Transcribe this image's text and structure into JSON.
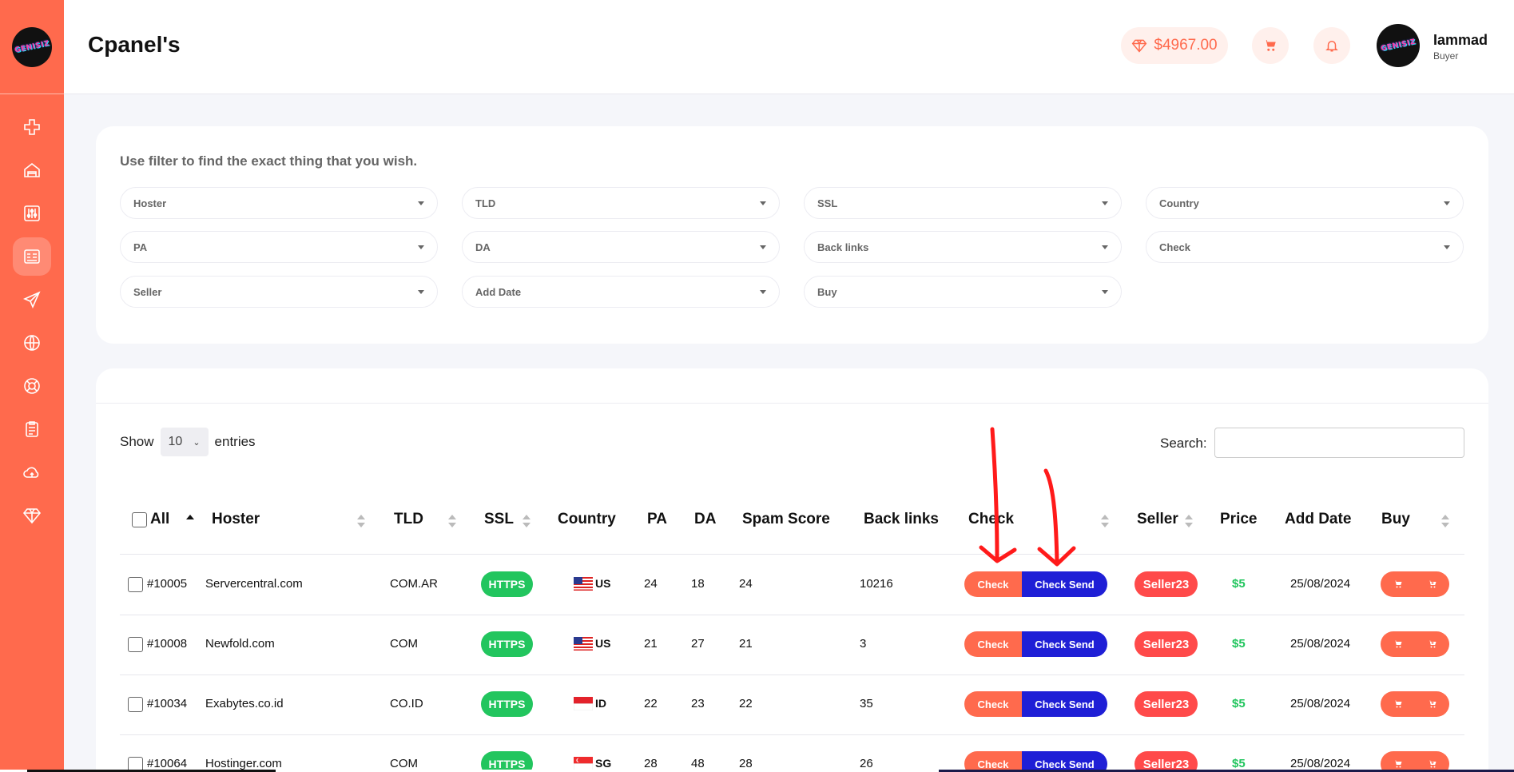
{
  "app": {
    "logo_text": "GENISIZ",
    "page_title": "Cpanel's"
  },
  "sidebar": {
    "items": [
      {
        "icon": "plus-icon"
      },
      {
        "icon": "home-icon"
      },
      {
        "icon": "sliders-icon"
      },
      {
        "icon": "list-icon",
        "active": true
      },
      {
        "icon": "send-icon"
      },
      {
        "icon": "globe-icon"
      },
      {
        "icon": "support-icon"
      },
      {
        "icon": "clipboard-icon"
      },
      {
        "icon": "cloud-icon"
      },
      {
        "icon": "diamond-icon"
      }
    ]
  },
  "header": {
    "balance": "$4967.00",
    "user_name": "Iammad",
    "user_role": "Buyer"
  },
  "filters": {
    "title": "Use filter to find the exact thing that you wish.",
    "selects": [
      "Hoster",
      "TLD",
      "SSL",
      "Country",
      "PA",
      "DA",
      "Back links",
      "Check",
      "Seller",
      "Add Date",
      "Buy"
    ]
  },
  "table": {
    "show_label": "Show",
    "entries_value": "10",
    "entries_label": "entries",
    "search_label": "Search:",
    "search_value": "",
    "columns": [
      "All",
      "Hoster",
      "TLD",
      "SSL",
      "Country",
      "PA",
      "DA",
      "Spam Score",
      "Back links",
      "Check",
      "Seller",
      "Price",
      "Add Date",
      "Buy"
    ],
    "check_label": "Check",
    "check_send_label": "Check Send",
    "rows": [
      {
        "id": "#10005",
        "hoster": "Servercentral.com",
        "tld": "COM.AR",
        "ssl": "HTTPS",
        "country": "US",
        "pa": "24",
        "da": "18",
        "spam": "24",
        "backlinks": "10216",
        "seller": "Seller23",
        "price": "$5",
        "date": "25/08/2024"
      },
      {
        "id": "#10008",
        "hoster": "Newfold.com",
        "tld": "COM",
        "ssl": "HTTPS",
        "country": "US",
        "pa": "21",
        "da": "27",
        "spam": "21",
        "backlinks": "3",
        "seller": "Seller23",
        "price": "$5",
        "date": "25/08/2024"
      },
      {
        "id": "#10034",
        "hoster": "Exabytes.co.id",
        "tld": "CO.ID",
        "ssl": "HTTPS",
        "country": "ID",
        "pa": "22",
        "da": "23",
        "spam": "22",
        "backlinks": "35",
        "seller": "Seller23",
        "price": "$5",
        "date": "25/08/2024"
      },
      {
        "id": "#10064",
        "hoster": "Hostinger.com",
        "tld": "COM",
        "ssl": "HTTPS",
        "country": "SG",
        "pa": "28",
        "da": "48",
        "spam": "28",
        "backlinks": "26",
        "seller": "Seller23",
        "price": "$5",
        "date": "25/08/2024"
      }
    ]
  },
  "colors": {
    "brand": "#ff6a4d",
    "ssl_green": "#22c55e",
    "seller_red": "#ff4a4a",
    "check_send_blue": "#1f1fd6",
    "annotation_red": "#ff1a1a"
  }
}
